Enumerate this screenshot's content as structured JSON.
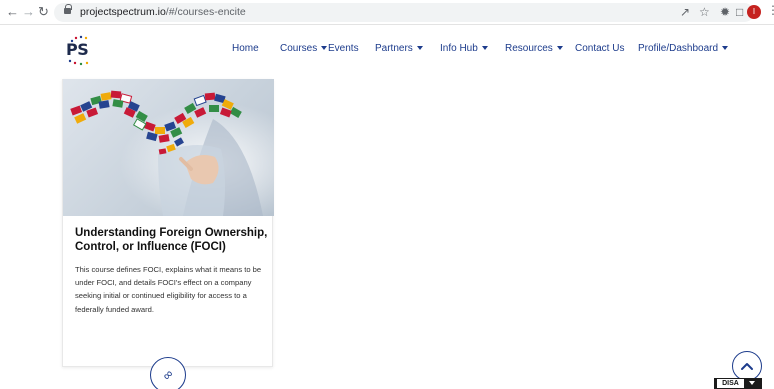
{
  "browser": {
    "url_host": "projectspectrum.io",
    "url_path": "/#/courses-encite",
    "profile_initial": "I",
    "icons": [
      "back-icon",
      "forward-icon",
      "reload-icon",
      "lock-icon",
      "share-icon",
      "star-icon",
      "extensions-icon",
      "sidebar-icon",
      "profile-icon",
      "menu-icon"
    ]
  },
  "header": {
    "logo_text": "PS",
    "menu": [
      {
        "label": "Home",
        "dropdown": false
      },
      {
        "label": "Courses",
        "dropdown": true
      },
      {
        "label": "Events",
        "dropdown": false
      },
      {
        "label": "Partners",
        "dropdown": true
      },
      {
        "label": "Info Hub",
        "dropdown": true
      },
      {
        "label": "Resources",
        "dropdown": true
      },
      {
        "label": "Contact Us",
        "dropdown": false
      },
      {
        "label": "Profile/Dashboard",
        "dropdown": true
      }
    ]
  },
  "course_card": {
    "title": "Understanding Foreign Ownership, Control, or Influence (FOCI)",
    "description": "This course defines FOCI, explains what it means to be under FOCI, and details FOCI's effect on a company seeking initial or continued eligibility for access to a federally funded award.",
    "image": "flags-world-hand-image",
    "link_icon": "link-icon"
  },
  "widgets": {
    "scroll_top_icon": "chevron-up-icon",
    "badge_label": "DISA"
  },
  "colors": {
    "nav_blue": "#1d3c8c",
    "logo_navy": "#1d2a4c"
  }
}
